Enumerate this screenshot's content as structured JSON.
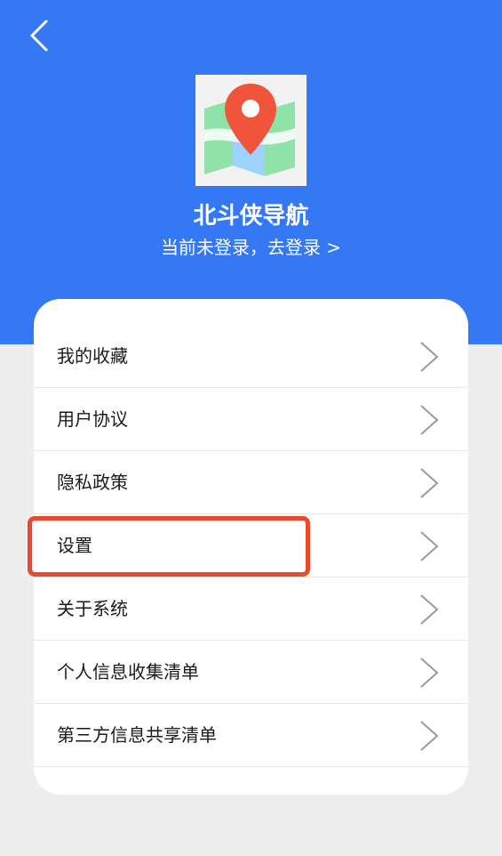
{
  "header": {
    "back_icon": "chevron-left-icon",
    "logo_icon": "map-pin-icon",
    "app_name": "北斗侠导航",
    "login_prompt": "当前未登录，去登录 >"
  },
  "menu": {
    "items": [
      {
        "label": "我的收藏"
      },
      {
        "label": "用户协议"
      },
      {
        "label": "隐私政策"
      },
      {
        "label": "设置"
      },
      {
        "label": "关于系统"
      },
      {
        "label": "个人信息收集清单"
      },
      {
        "label": "第三方信息共享清单"
      }
    ]
  },
  "colors": {
    "header_bg": "#3478f6",
    "highlight": "#e74a2c",
    "pin": "#f0543a"
  }
}
